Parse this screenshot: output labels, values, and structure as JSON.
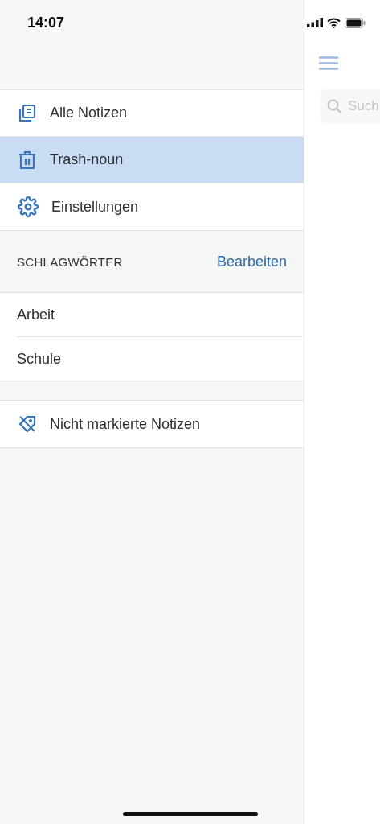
{
  "status_bar": {
    "time": "14:07"
  },
  "nav_items": [
    {
      "label": "Alle Notizen",
      "selected": false
    },
    {
      "label": "Trash-noun",
      "selected": true
    },
    {
      "label": "Einstellungen",
      "selected": false
    }
  ],
  "tags_section": {
    "title": "SCHLAGWÖRTER",
    "edit_action": "Bearbeiten",
    "tags": [
      "Arbeit",
      "Schule"
    ]
  },
  "untagged_item": {
    "label": "Nicht markierte Notizen",
    "selected": false
  },
  "search": {
    "placeholder": "Such"
  }
}
